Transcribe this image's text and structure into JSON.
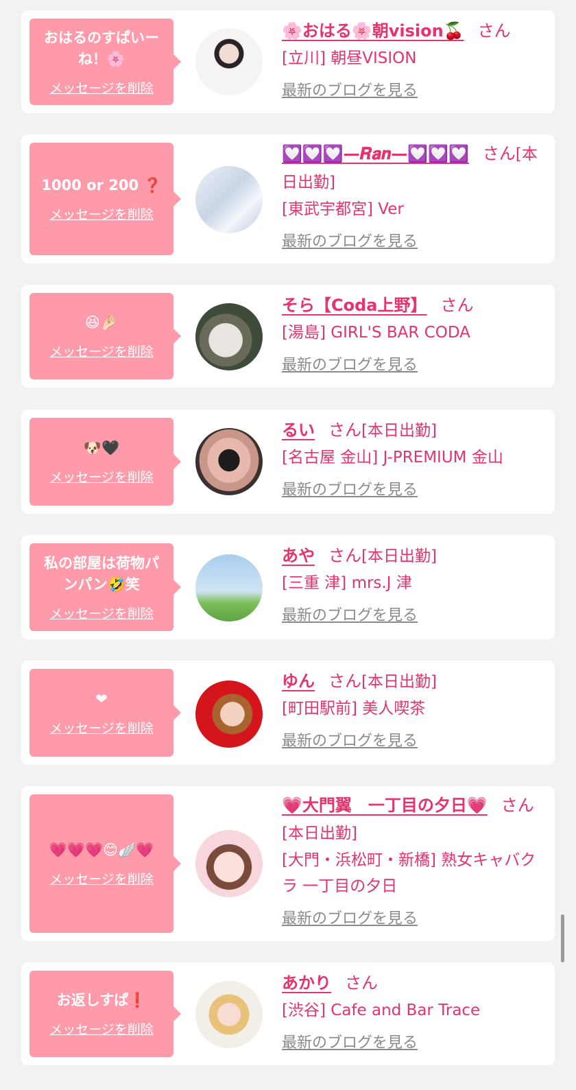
{
  "delete_label": "メッセージを削除",
  "blog_label": "最新のブログを見る",
  "san_label": "さん",
  "colors": {
    "accent": "#e5336d",
    "bubble": "#ff9aaa",
    "link_gray": "#8a8a8a",
    "background": "#f2f2f2"
  },
  "cards": [
    {
      "message": "おはるのすぱいー\nね！🌸",
      "name": "🌸おはる🌸朝vision🍒",
      "status": "",
      "shop": "[立川] 朝昼VISION"
    },
    {
      "message": "1000 or 200 ❓",
      "name": "💟💟💟—𝑹𝒂𝒏—💟💟💟",
      "status": "[本日出勤]",
      "shop": "[東武宇都宮] Ver"
    },
    {
      "message": "😆🤌🏻",
      "name": "そら【Coda上野】",
      "status": "",
      "shop": "[湯島] GIRL'S BAR CODA"
    },
    {
      "message": "🐶🖤",
      "name": "るい",
      "status": "[本日出勤]",
      "shop": "[名古屋 金山] J-PREMIUM 金山"
    },
    {
      "message": "私の部屋は荷物パ\nンパン🤣笑",
      "name": "あや",
      "status": "[本日出勤]",
      "shop": "[三重 津] mrs.J 津"
    },
    {
      "message": "❤",
      "name": "ゆん",
      "status": "[本日出勤]",
      "shop": "[町田駅前] 美人喫茶"
    },
    {
      "message": "💗💗💗😊🪽💗",
      "name": "💗大門翼　一丁目の夕日💗",
      "status": "[本日出勤]",
      "shop": "[大門・浜松町・新橋] 熟女キャバクラ 一丁目の夕日"
    },
    {
      "message": "お返しすぱ❗️",
      "name": "あかり",
      "status": "",
      "shop": "[渋谷] Cafe and Bar Trace"
    }
  ]
}
